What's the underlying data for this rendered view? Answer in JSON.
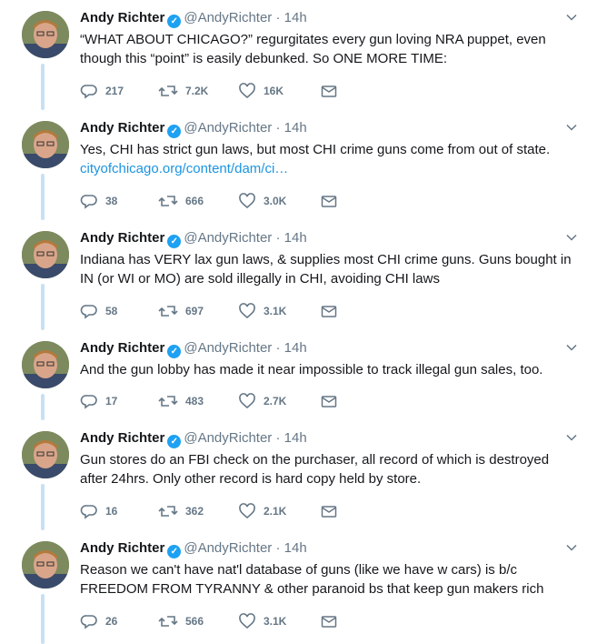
{
  "tweets": [
    {
      "name": "Andy Richter",
      "handle": "@AndyRichter",
      "dot": "·",
      "time": "14h",
      "text": "“WHAT ABOUT CHICAGO?” regurgitates every gun loving NRA puppet, even though this “point” is easily debunked. So ONE MORE TIME:",
      "link": "",
      "replies": "217",
      "retweets": "7.2K",
      "likes": "16K"
    },
    {
      "name": "Andy Richter",
      "handle": "@AndyRichter",
      "dot": "·",
      "time": "14h",
      "text": "Yes, CHI has strict gun laws, but most CHI crime guns come from out of state.",
      "link": "cityofchicago.org/content/dam/ci…",
      "replies": "38",
      "retweets": "666",
      "likes": "3.0K"
    },
    {
      "name": "Andy Richter",
      "handle": "@AndyRichter",
      "dot": "·",
      "time": "14h",
      "text": "Indiana has VERY lax gun laws, & supplies most CHI crime guns. Guns bought in IN (or WI or MO) are sold illegally in CHI, avoiding CHI laws",
      "link": "",
      "replies": "58",
      "retweets": "697",
      "likes": "3.1K"
    },
    {
      "name": "Andy Richter",
      "handle": "@AndyRichter",
      "dot": "·",
      "time": "14h",
      "text": "And the gun lobby has made it near impossible to track illegal gun sales, too.",
      "link": "",
      "replies": "17",
      "retweets": "483",
      "likes": "2.7K"
    },
    {
      "name": "Andy Richter",
      "handle": "@AndyRichter",
      "dot": "·",
      "time": "14h",
      "text": "Gun stores do an FBI check on the purchaser, all record of which is destroyed after 24hrs. Only other record is hard copy held by store.",
      "link": "",
      "replies": "16",
      "retweets": "362",
      "likes": "2.1K"
    },
    {
      "name": "Andy Richter",
      "handle": "@AndyRichter",
      "dot": "·",
      "time": "14h",
      "text": "Reason we can't have nat'l database of guns (like we have w cars) is b/c FREEDOM FROM TYRANNY & other paranoid bs that keep gun makers rich",
      "link": "",
      "replies": "26",
      "retweets": "566",
      "likes": "3.1K"
    }
  ],
  "colors": {
    "accent": "#1da1f2",
    "link": "#1b95e0",
    "muted": "#657786",
    "thread_line": "#c8e0f4"
  },
  "icons": {
    "verified": "verified-badge-icon",
    "caret": "chevron-down-icon",
    "reply": "reply-icon",
    "retweet": "retweet-icon",
    "like": "heart-icon",
    "dm": "envelope-icon"
  }
}
